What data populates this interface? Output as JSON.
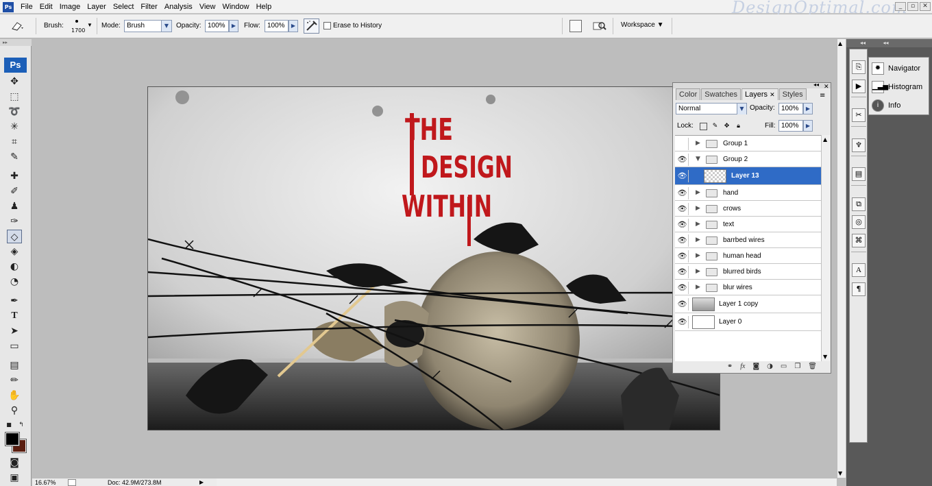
{
  "app": {
    "logo": "Ps",
    "watermark": "DesignOptimal.com",
    "menus": [
      "File",
      "Edit",
      "Image",
      "Layer",
      "Select",
      "Filter",
      "Analysis",
      "View",
      "Window",
      "Help"
    ],
    "window_buttons": [
      "_",
      "▫",
      "✕"
    ]
  },
  "options": {
    "brush_label": "Brush:",
    "brush_size": "1700",
    "mode_label": "Mode:",
    "mode_value": "Brush",
    "opacity_label": "Opacity:",
    "opacity_value": "100%",
    "flow_label": "Flow:",
    "flow_value": "100%",
    "erase_history_label": "Erase to History",
    "workspace_label": "Workspace ▼"
  },
  "tools": {
    "logo": "Ps",
    "active_tool": "eraser-tool",
    "foreground_color": "#000000",
    "background_color": "#5b1e10"
  },
  "artwork": {
    "headline": [
      "THE",
      "DESIGN",
      "WITHIN"
    ],
    "headline_color": "#c0181c"
  },
  "status": {
    "zoom": "16.67%",
    "doc": "Doc: 42.9M/273.8M"
  },
  "dock": {
    "panels": [
      "Navigator",
      "Histogram",
      "Info"
    ]
  },
  "layers_panel": {
    "tabs": [
      "Color",
      "Swatches",
      "Layers",
      "Styles"
    ],
    "selected_tab": "Layers",
    "blend_mode": "Normal",
    "opacity_label": "Opacity:",
    "opacity_value": "100%",
    "lock_label": "Lock:",
    "fill_label": "Fill:",
    "fill_value": "100%",
    "layers": [
      {
        "name": "Group 1",
        "type": "group",
        "visible": false,
        "expanded": false,
        "selected": false
      },
      {
        "name": "Group 2",
        "type": "group",
        "visible": true,
        "expanded": true,
        "selected": false
      },
      {
        "name": "Layer 13",
        "type": "layer",
        "visible": true,
        "expanded": false,
        "selected": true
      },
      {
        "name": "hand",
        "type": "group",
        "visible": true,
        "expanded": false,
        "selected": false
      },
      {
        "name": "crows",
        "type": "group",
        "visible": true,
        "expanded": false,
        "selected": false
      },
      {
        "name": "text",
        "type": "group",
        "visible": true,
        "expanded": false,
        "selected": false
      },
      {
        "name": "barrbed wires",
        "type": "group",
        "visible": true,
        "expanded": false,
        "selected": false
      },
      {
        "name": "human head",
        "type": "group",
        "visible": true,
        "expanded": false,
        "selected": false
      },
      {
        "name": "blurred birds",
        "type": "group",
        "visible": true,
        "expanded": false,
        "selected": false
      },
      {
        "name": "blur wires",
        "type": "group",
        "visible": true,
        "expanded": false,
        "selected": false
      },
      {
        "name": "Layer 1 copy",
        "type": "layer",
        "visible": true,
        "expanded": false,
        "selected": false
      },
      {
        "name": "Layer 0",
        "type": "layer",
        "visible": true,
        "expanded": false,
        "selected": false
      }
    ]
  }
}
